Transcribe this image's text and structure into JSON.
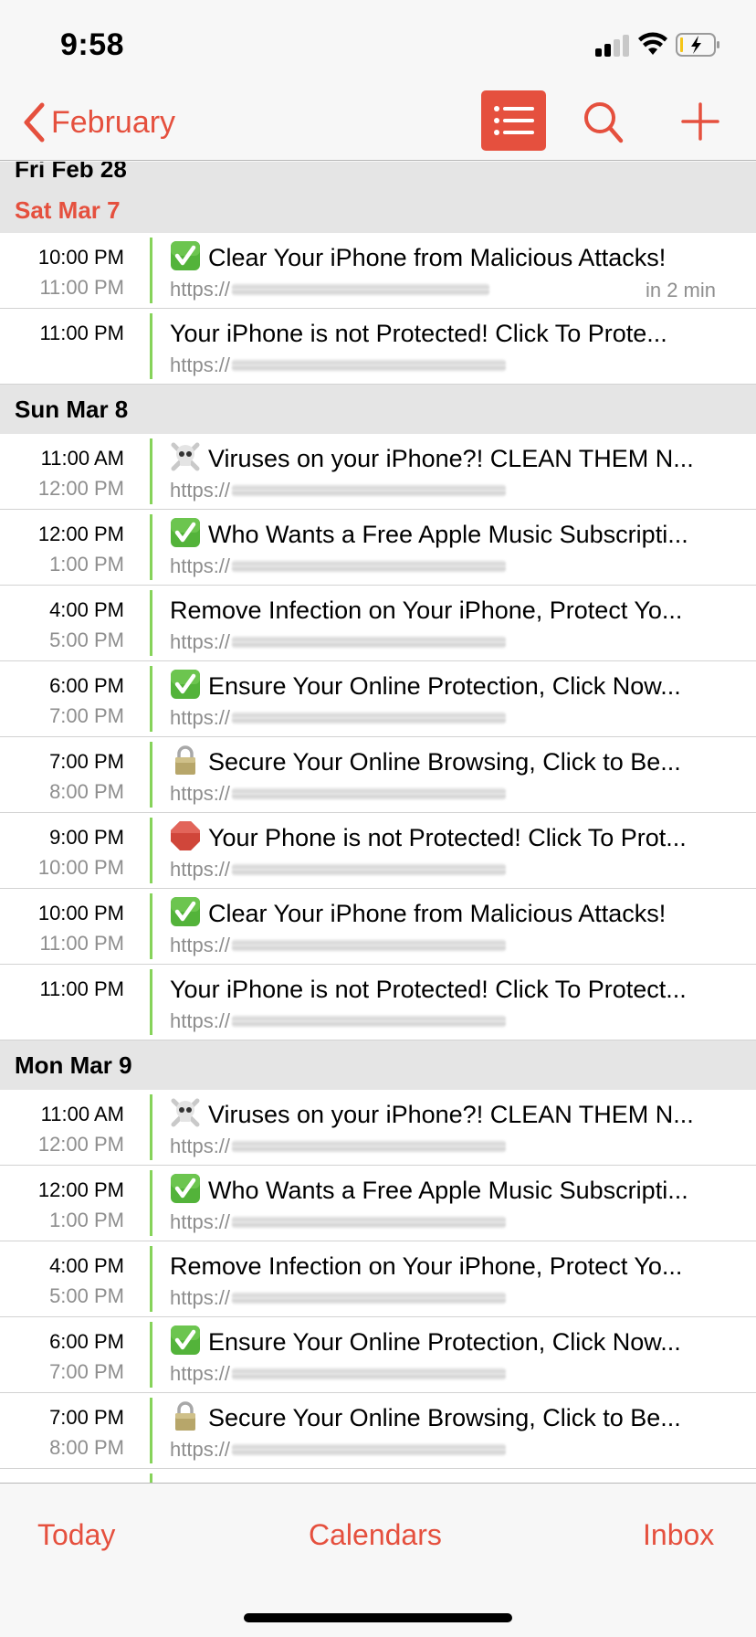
{
  "status_bar": {
    "time": "9:58",
    "signal_bars_active": 2,
    "signal_bars_total": 4,
    "battery_charging": true,
    "battery_level_color": "#f5c518"
  },
  "nav": {
    "back_label": "February",
    "back_icon": "chevron-left-icon",
    "list_icon": "list-icon",
    "search_icon": "search-icon",
    "add_icon": "plus-icon",
    "accent_color": "#e5503e"
  },
  "days": [
    {
      "label": "Fri  Feb 28",
      "today": false,
      "events": []
    },
    {
      "label": "Sat  Mar 7",
      "today": true,
      "events": [
        {
          "start": "10:00 PM",
          "end": "11:00 PM",
          "emoji": "check",
          "title": "Clear Your iPhone from Malicious Attacks!",
          "url": "https://",
          "relative": "in 2 min"
        },
        {
          "start": "11:00 PM",
          "end": "",
          "emoji": "",
          "title": "Your iPhone is not Protected! Click To Prote...",
          "url": "https://",
          "relative": ""
        }
      ]
    },
    {
      "label": "Sun  Mar 8",
      "today": false,
      "events": [
        {
          "start": "11:00 AM",
          "end": "12:00 PM",
          "emoji": "skull",
          "title": "Viruses on your iPhone?! CLEAN THEM N...",
          "url": "https://",
          "relative": ""
        },
        {
          "start": "12:00 PM",
          "end": "1:00 PM",
          "emoji": "check",
          "title": "Who Wants a Free Apple Music Subscripti...",
          "url": "https://",
          "relative": ""
        },
        {
          "start": "4:00 PM",
          "end": "5:00 PM",
          "emoji": "",
          "title": "Remove Infection on Your iPhone, Protect Yo...",
          "url": "https://",
          "relative": ""
        },
        {
          "start": "6:00 PM",
          "end": "7:00 PM",
          "emoji": "check",
          "title": "Ensure Your Online Protection, Click Now...",
          "url": "https://",
          "relative": ""
        },
        {
          "start": "7:00 PM",
          "end": "8:00 PM",
          "emoji": "lock",
          "title": "Secure Your Online Browsing, Click to Be...",
          "url": "https://",
          "relative": ""
        },
        {
          "start": "9:00 PM",
          "end": "10:00 PM",
          "emoji": "stop",
          "title": "Your Phone is not Protected! Click To Prot...",
          "url": "https://",
          "relative": ""
        },
        {
          "start": "10:00 PM",
          "end": "11:00 PM",
          "emoji": "check",
          "title": "Clear Your iPhone from Malicious Attacks!",
          "url": "https://",
          "relative": ""
        },
        {
          "start": "11:00 PM",
          "end": "",
          "emoji": "",
          "title": "Your iPhone is not Protected! Click To Protect...",
          "url": "https://",
          "relative": ""
        }
      ]
    },
    {
      "label": "Mon  Mar 9",
      "today": false,
      "events": [
        {
          "start": "11:00 AM",
          "end": "12:00 PM",
          "emoji": "skull",
          "title": "Viruses on your iPhone?! CLEAN THEM N...",
          "url": "https://",
          "relative": ""
        },
        {
          "start": "12:00 PM",
          "end": "1:00 PM",
          "emoji": "check",
          "title": "Who Wants a Free Apple Music Subscripti...",
          "url": "https://",
          "relative": ""
        },
        {
          "start": "4:00 PM",
          "end": "5:00 PM",
          "emoji": "",
          "title": "Remove Infection on Your iPhone, Protect Yo...",
          "url": "https://",
          "relative": ""
        },
        {
          "start": "6:00 PM",
          "end": "7:00 PM",
          "emoji": "check",
          "title": "Ensure Your Online Protection, Click Now...",
          "url": "https://",
          "relative": ""
        },
        {
          "start": "7:00 PM",
          "end": "8:00 PM",
          "emoji": "lock",
          "title": "Secure Your Online Browsing, Click to Be...",
          "url": "https://",
          "relative": ""
        }
      ]
    }
  ],
  "event_calendar_color": "#86d35a",
  "tab_bar": {
    "today_label": "Today",
    "calendars_label": "Calendars",
    "inbox_label": "Inbox"
  }
}
